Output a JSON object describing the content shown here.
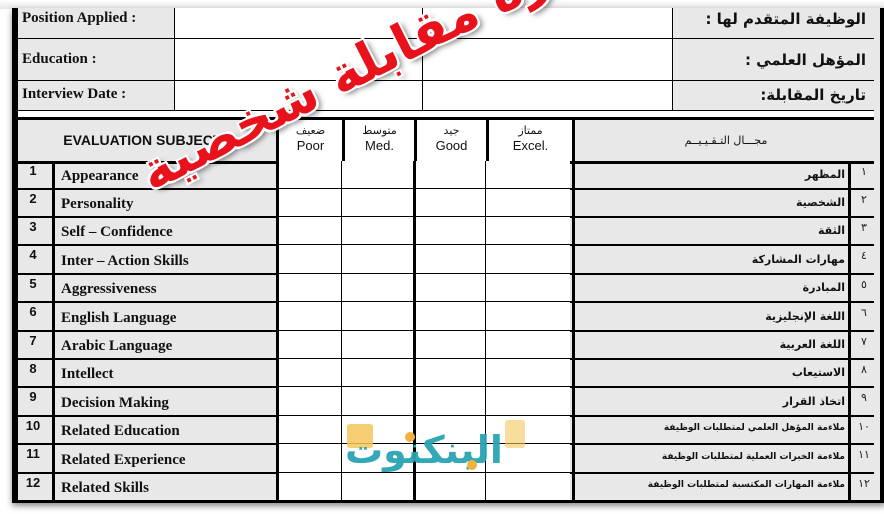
{
  "header_fields": [
    {
      "label_en": "Position Applied :",
      "label_ar": "الوظيفة المتقدم لها :",
      "value": ""
    },
    {
      "label_en": "Education :",
      "label_ar": "المؤهل العلمي :",
      "value": ""
    },
    {
      "label_en": "Interview Date :",
      "label_ar": "تاريخ المقابلة:",
      "value": ""
    }
  ],
  "evaluation": {
    "title_en": "EVALUATION SUBJECTS",
    "title_ar": "مجـــال التـقـيـيــم",
    "ratings": [
      {
        "ar": "ضعيف",
        "en": "Poor"
      },
      {
        "ar": "متوسط",
        "en": "Med."
      },
      {
        "ar": "جيد",
        "en": "Good"
      },
      {
        "ar": "ممتاز",
        "en": "Excel."
      }
    ],
    "subjects": [
      {
        "num": "1",
        "en": "Appearance",
        "ar": "المظهر",
        "ar_num": "١"
      },
      {
        "num": "2",
        "en": "Personality",
        "ar": "الشخصية",
        "ar_num": "٢"
      },
      {
        "num": "3",
        "en": "Self – Confidence",
        "ar": "الثقة",
        "ar_num": "٣"
      },
      {
        "num": "4",
        "en": "Inter – Action Skills",
        "ar": "مهارات المشاركة",
        "ar_num": "٤"
      },
      {
        "num": "5",
        "en": "Aggressiveness",
        "ar": "المبادرة",
        "ar_num": "٥"
      },
      {
        "num": "6",
        "en": "English Language",
        "ar": "اللغة الإنجليزية",
        "ar_num": "٦"
      },
      {
        "num": "7",
        "en": "Arabic Language",
        "ar": "اللغة العربية",
        "ar_num": "٧"
      },
      {
        "num": "8",
        "en": "Intellect",
        "ar": "الاستيعاب",
        "ar_num": "٨"
      },
      {
        "num": "9",
        "en": "Decision Making",
        "ar": "اتخاذ القرار",
        "ar_num": "٩"
      },
      {
        "num": "10",
        "en": "Related Education",
        "ar": "ملاءمة المؤهل العلمي لمتطلبات الوظيفة",
        "ar_num": "١٠"
      },
      {
        "num": "11",
        "en": "Related Experience",
        "ar": "ملاءمة الخبرات العملية لمتطلبات الوظيفة",
        "ar_num": "١١"
      },
      {
        "num": "12",
        "en": "Related Skills",
        "ar": "ملاءمة المهارات المكتسبة لمتطلبات الوظيفة",
        "ar_num": "١٢"
      }
    ]
  },
  "watermark": {
    "text": "نموذج استمارة مقابلة شخصية",
    "color": "#e8121c"
  },
  "logo": {
    "text": "البنكنوت",
    "color": "#2aa4b4",
    "accent": "#f2b33d"
  }
}
